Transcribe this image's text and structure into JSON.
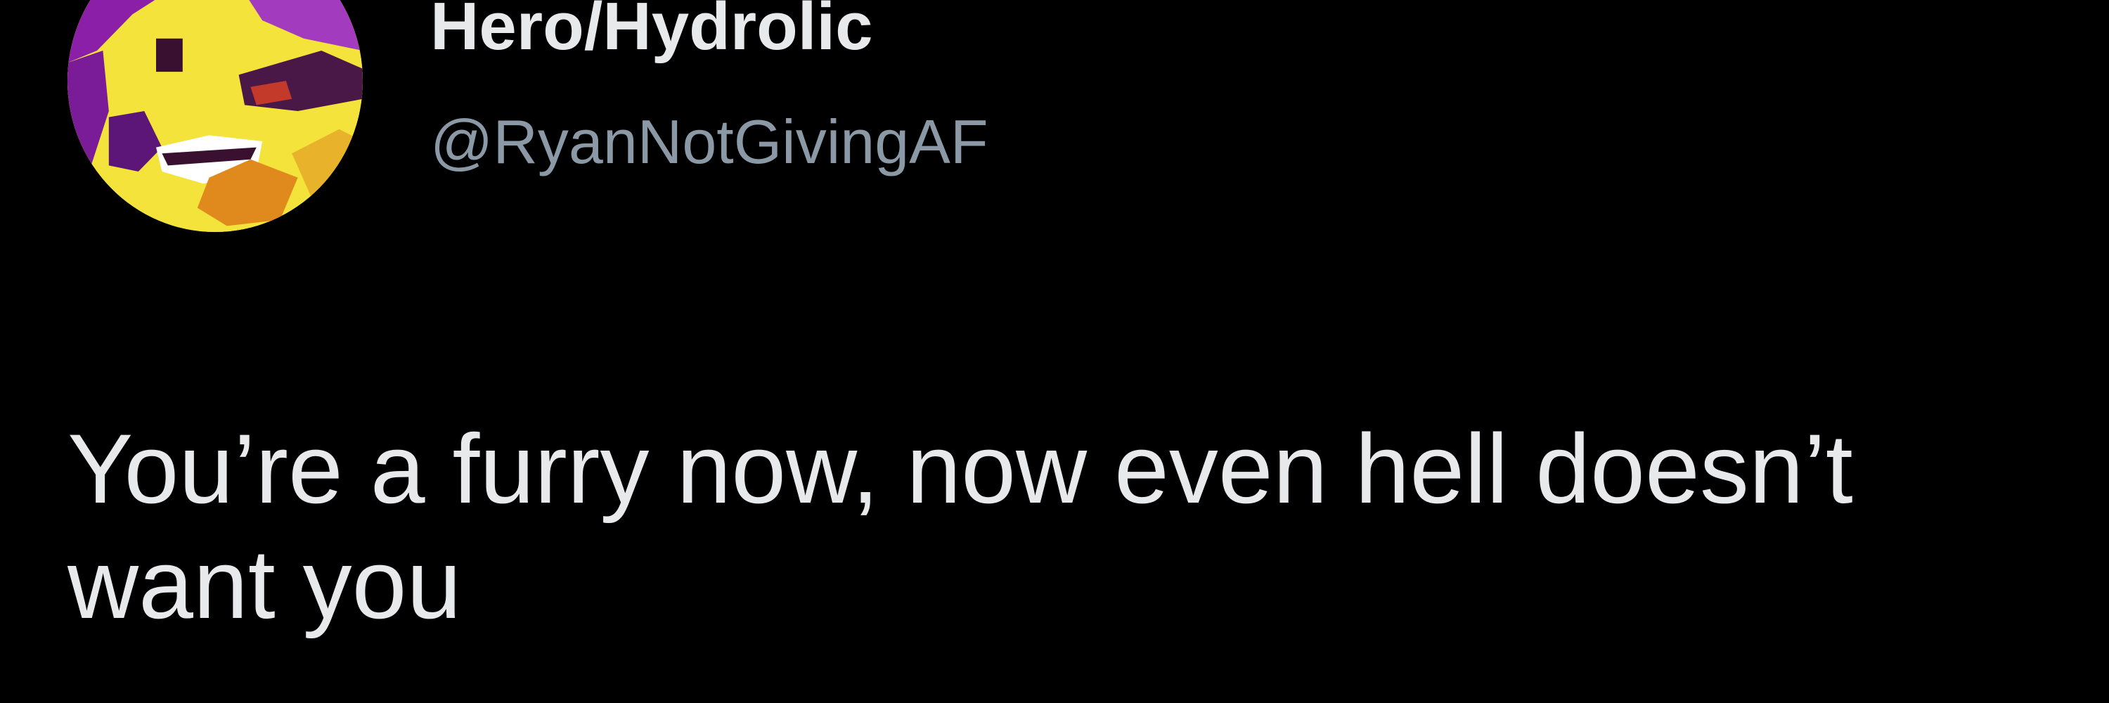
{
  "tweet": {
    "author": {
      "display_name": "Hero/Hydrolic",
      "handle": "@RyanNotGivingAF",
      "avatar_icon": "pixel-art-yellow-creature-avatar"
    },
    "text": "You’re a furry now, now even hell doesn’t want you"
  },
  "colors": {
    "background": "#000000",
    "primary_text": "#e7e9ea",
    "secondary_text": "#8b98a5"
  }
}
